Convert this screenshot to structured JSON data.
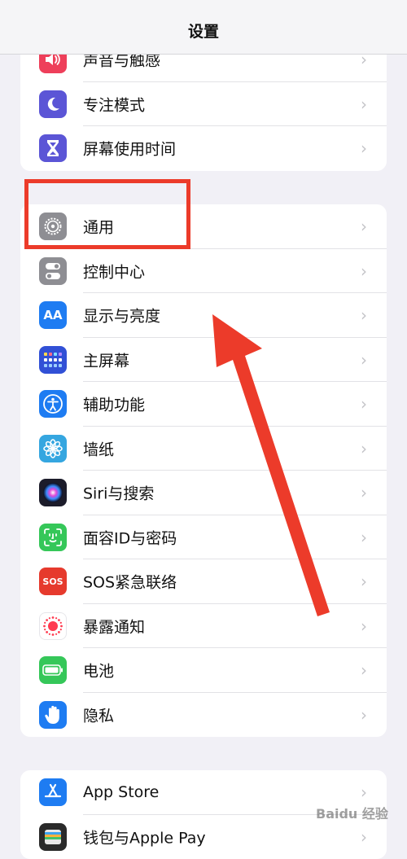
{
  "header": {
    "title": "设置"
  },
  "groups": [
    {
      "items": [
        {
          "label": "声音与触感",
          "icon": "speaker-icon",
          "color": "#ee3f5a"
        },
        {
          "label": "专注模式",
          "icon": "moon-icon",
          "color": "#5b55d6"
        },
        {
          "label": "屏幕使用时间",
          "icon": "hourglass-icon",
          "color": "#5b55d6"
        }
      ]
    },
    {
      "items": [
        {
          "label": "通用",
          "icon": "gear-icon",
          "color": "#8e8e93"
        },
        {
          "label": "控制中心",
          "icon": "toggles-icon",
          "color": "#8e8e93"
        },
        {
          "label": "显示与亮度",
          "icon": "aa-icon",
          "color": "#1e7cf2",
          "icon_text": "AA"
        },
        {
          "label": "主屏幕",
          "icon": "home-grid-icon",
          "color": "#3150d6"
        },
        {
          "label": "辅助功能",
          "icon": "accessibility-icon",
          "color": "#1e7cf2"
        },
        {
          "label": "墙纸",
          "icon": "flower-icon",
          "color": "#35a6e0"
        },
        {
          "label": "Siri与搜索",
          "icon": "siri-icon",
          "color": "#1c1c2a"
        },
        {
          "label": "面容ID与密码",
          "icon": "face-id-icon",
          "color": "#35c759"
        },
        {
          "label": "SOS紧急联络",
          "icon": "sos-icon",
          "color": "#e63a2d",
          "icon_text": "SOS"
        },
        {
          "label": "暴露通知",
          "icon": "exposure-icon",
          "color": "#ffffff"
        },
        {
          "label": "电池",
          "icon": "battery-icon",
          "color": "#35c759"
        },
        {
          "label": "隐私",
          "icon": "hand-icon",
          "color": "#1e7cf2"
        }
      ]
    },
    {
      "items": [
        {
          "label": "App Store",
          "icon": "app-store-icon",
          "color": "#1e7cf2"
        },
        {
          "label": "钱包与Apple Pay",
          "icon": "wallet-icon",
          "color": "#2a2a2a"
        }
      ]
    }
  ],
  "annotation": {
    "highlight_color": "#ec3b2a"
  },
  "watermark": {
    "text": "Baidu 经验"
  }
}
